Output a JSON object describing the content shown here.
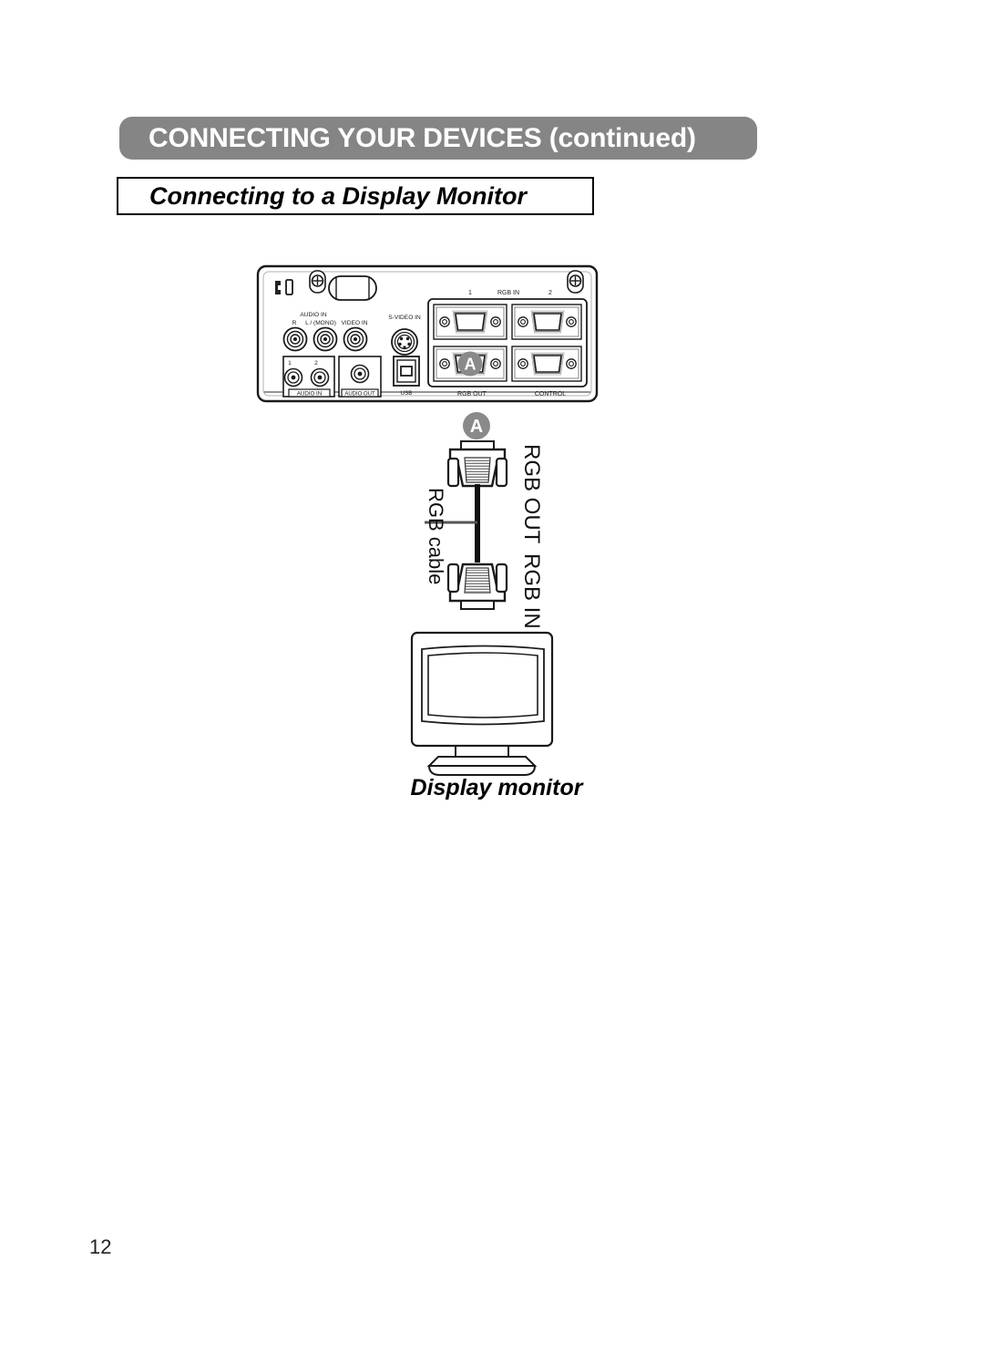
{
  "page": {
    "number": "12",
    "header_title": "CONNECTING YOUR DEVICES (continued)",
    "subtitle": "Connecting to a Display Monitor",
    "banner_color": "#858585",
    "text_color": "#000000",
    "banner_text_color": "#ffffff"
  },
  "panel": {
    "security_slot": "security-lock-slot",
    "labels": {
      "audio_in_top": "AUDIO IN",
      "audio_r": "R",
      "audio_l_mono": "L / (MONO)",
      "video_in": "VIDEO IN",
      "s_video_in": "S-VIDEO IN",
      "audio_in_1": "1",
      "audio_in_2": "2",
      "audio_in_bottom": "AUDIO IN",
      "audio_out": "AUDIO OUT",
      "usb": "USB",
      "rgb_in": "RGB  IN",
      "rgb_in_1": "1",
      "rgb_in_2": "2",
      "rgb_out": "RGB  OUT",
      "control": "CONTROL"
    }
  },
  "cable": {
    "badge": "A",
    "badge_color": "#858585",
    "top_connector_label": "RGB OUT",
    "bottom_connector_label": "RGB IN",
    "cable_label": "RGB cable"
  },
  "monitor": {
    "caption": "Display monitor"
  }
}
